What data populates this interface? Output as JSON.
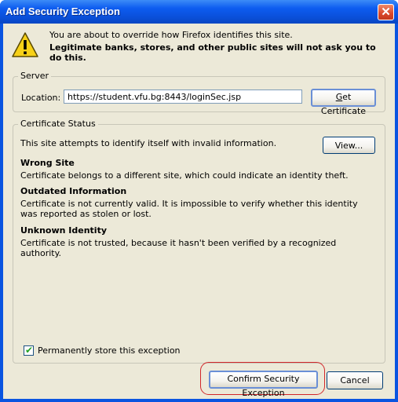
{
  "window": {
    "title": "Add Security Exception",
    "close_symbol": "✕"
  },
  "intro": {
    "line1": "You are about to override how Firefox identifies this site.",
    "line2": "Legitimate banks, stores, and other public sites will not ask you to do this."
  },
  "server": {
    "legend": "Server",
    "location_label": "Location:",
    "location_value": "https://student.vfu.bg:8443/loginSec.jsp",
    "get_cert_prefix": "",
    "get_cert_access": "G",
    "get_cert_rest": "et Certificate"
  },
  "status": {
    "legend": "Certificate Status",
    "description": "This site attempts to identify itself with invalid information.",
    "view_label": "View...",
    "issues": [
      {
        "title": "Wrong Site",
        "text": "Certificate belongs to a different site, which could indicate an identity theft."
      },
      {
        "title": "Outdated Information",
        "text": "Certificate is not currently valid. It is impossible to verify whether this identity was reported as stolen or lost."
      },
      {
        "title": "Unknown Identity",
        "text": "Certificate is not trusted, because it hasn't been verified by a recognized authority."
      }
    ],
    "permanent_label": "Permanently store this exception",
    "permanent_checked": true
  },
  "buttons": {
    "confirm": "Confirm Security Exception",
    "cancel": "Cancel"
  },
  "colors": {
    "titlebar": "#0a54e0",
    "dialog_bg": "#ece9d8",
    "highlight_ring": "#d1262a"
  }
}
